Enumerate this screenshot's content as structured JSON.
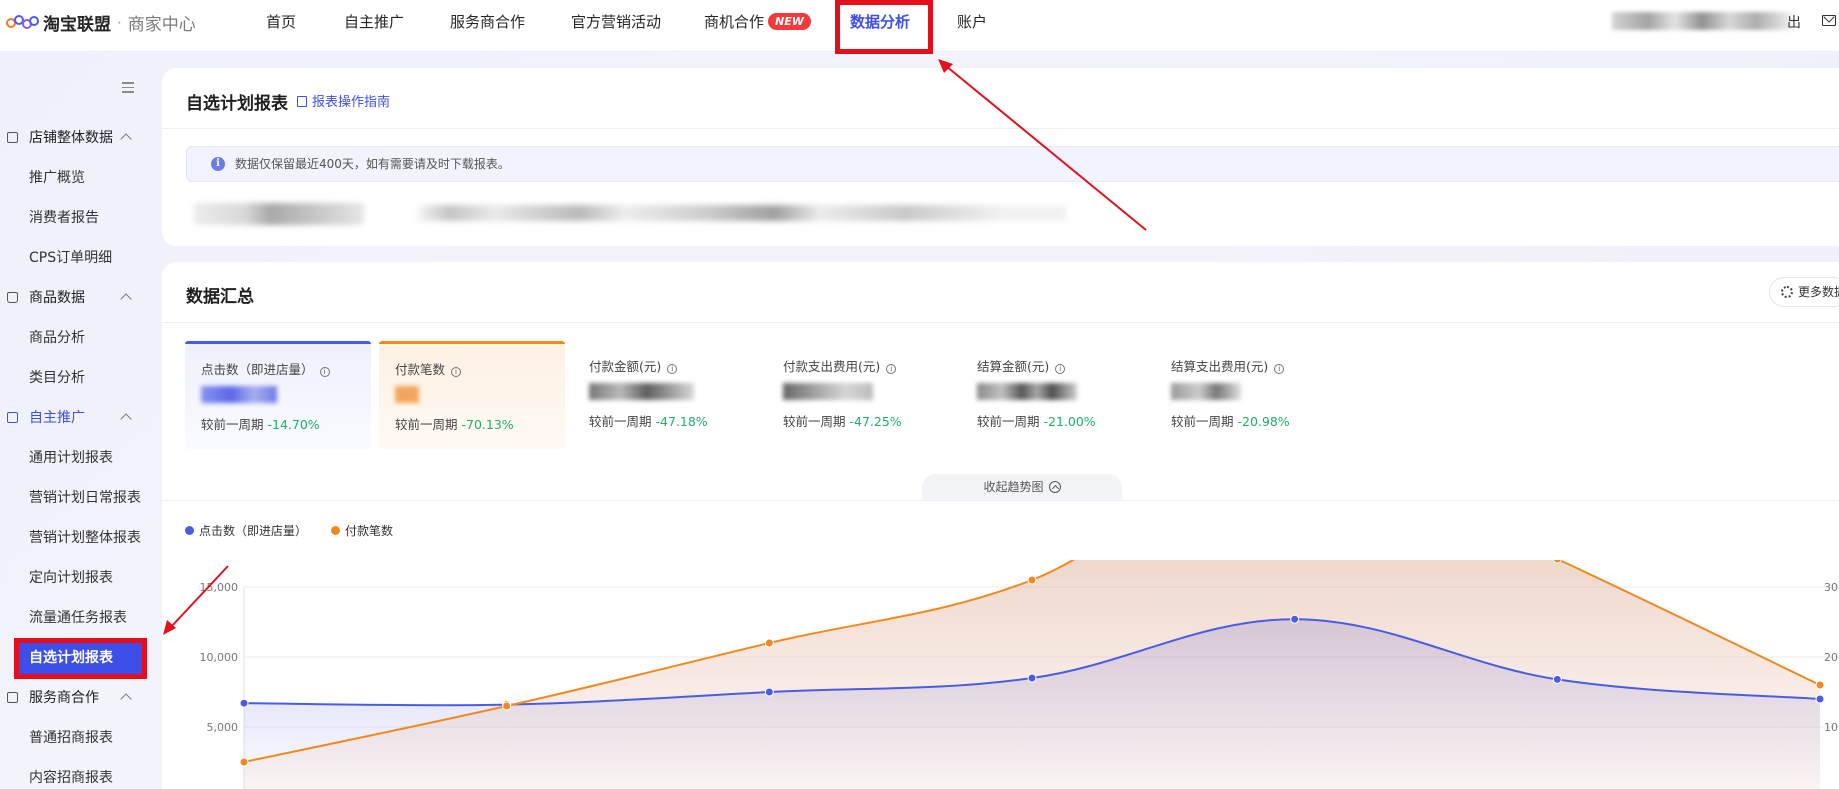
{
  "app": {
    "brand": "淘宝联盟",
    "separator": "·",
    "sub_brand": "商家中心"
  },
  "topnav": {
    "items": [
      {
        "label": "首页",
        "active": false
      },
      {
        "label": "自主推广",
        "active": false
      },
      {
        "label": "服务商合作",
        "active": false
      },
      {
        "label": "官方营销活动",
        "active": false
      },
      {
        "label": "商机合作",
        "badge": "NEW",
        "active": false
      },
      {
        "label": "数据分析",
        "active": true
      },
      {
        "label": "账户",
        "active": false
      }
    ],
    "logout_label": "出"
  },
  "sidebar": {
    "groups": [
      {
        "label": "店铺整体数据",
        "items": [
          "推广概览",
          "消费者报告",
          "CPS订单明细"
        ]
      },
      {
        "label": "商品数据",
        "items": [
          "商品分析",
          "类目分析"
        ]
      },
      {
        "label": "自主推广",
        "items": [
          "通用计划报表",
          "营销计划日常报表",
          "营销计划整体报表",
          "定向计划报表",
          "流量通任务报表",
          "自选计划报表"
        ]
      },
      {
        "label": "服务商合作",
        "items": [
          "普通招商报表",
          "内容招商报表"
        ]
      }
    ],
    "active_item": "自选计划报表"
  },
  "report": {
    "title": "自选计划报表",
    "guide_link": "报表操作指南",
    "notice": "数据仅保留最近400天，如有需要请及时下载报表。"
  },
  "summary": {
    "title": "数据汇总",
    "more_button": "更多数据",
    "collapse_label": "收起趋势图",
    "metrics": [
      {
        "label": "点击数（即进店量）",
        "compare_label": "较前一周期",
        "change": "-14.70%"
      },
      {
        "label": "付款笔数",
        "compare_label": "较前一周期",
        "change": "-70.13%"
      },
      {
        "label": "付款金额(元)",
        "compare_label": "较前一周期",
        "change": "-47.18%"
      },
      {
        "label": "付款支出费用(元)",
        "compare_label": "较前一周期",
        "change": "-47.25%"
      },
      {
        "label": "结算金额(元)",
        "compare_label": "较前一周期",
        "change": "-21.00%"
      },
      {
        "label": "结算支出费用(元)",
        "compare_label": "较前一周期",
        "change": "-20.98%"
      }
    ]
  },
  "colors": {
    "accent": "#3d4fe8",
    "series_click": "#4a5ce6",
    "series_pay": "#f08a1f",
    "positive_change": "#19b26b",
    "annotation_red": "#e3101c"
  },
  "chart_data": {
    "type": "line",
    "series": [
      {
        "name": "点击数（即进店量）",
        "axis": "left",
        "values": [
          6700,
          6600,
          7500,
          8500,
          12700,
          8400,
          7000
        ]
      },
      {
        "name": "付款笔数",
        "axis": "right",
        "values": [
          5,
          13,
          22,
          31,
          51,
          34,
          16
        ]
      }
    ],
    "y_left_ticks": [
      "5,000",
      "10,000",
      "15,000"
    ],
    "y_left_lim": [
      0,
      15000
    ],
    "y_right_ticks": [
      "10",
      "20",
      "30"
    ],
    "y_right_lim": [
      0,
      60
    ],
    "grid": true
  }
}
